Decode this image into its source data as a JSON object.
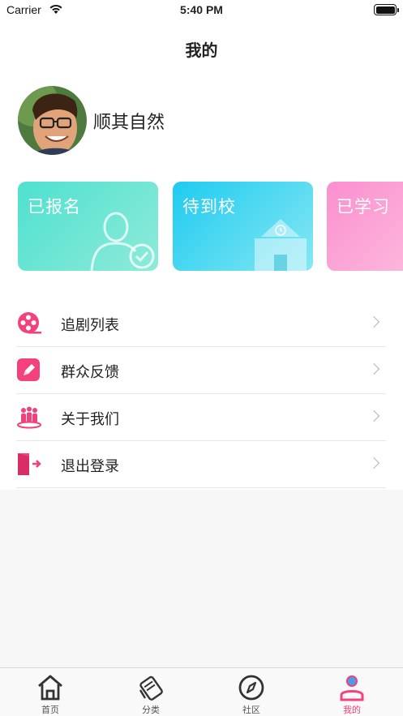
{
  "status_bar": {
    "carrier": "Carrier",
    "time": "5:40 PM"
  },
  "nav": {
    "title": "我的"
  },
  "profile": {
    "username": "顺其自然"
  },
  "cards": [
    {
      "label": "已报名",
      "icon": "user-check-icon"
    },
    {
      "label": "待到校",
      "icon": "school-building-icon"
    },
    {
      "label": "已学习",
      "icon": "book-icon"
    }
  ],
  "menu": [
    {
      "label": "追剧列表",
      "icon": "film-reel-icon"
    },
    {
      "label": "群众反馈",
      "icon": "pencil-icon"
    },
    {
      "label": "关于我们",
      "icon": "people-group-icon"
    },
    {
      "label": "退出登录",
      "icon": "logout-door-icon"
    }
  ],
  "tabs": [
    {
      "label": "首页",
      "icon": "home-icon",
      "active": false
    },
    {
      "label": "分类",
      "icon": "tags-icon",
      "active": false
    },
    {
      "label": "社区",
      "icon": "compass-icon",
      "active": false
    },
    {
      "label": "我的",
      "icon": "person-icon",
      "active": true
    }
  ],
  "colors": {
    "accent": "#f2417b",
    "card_1": "#4ee1cf",
    "card_2": "#1ecbf0",
    "card_3": "#fb8fcf",
    "menu_icon": "#f2417b"
  }
}
